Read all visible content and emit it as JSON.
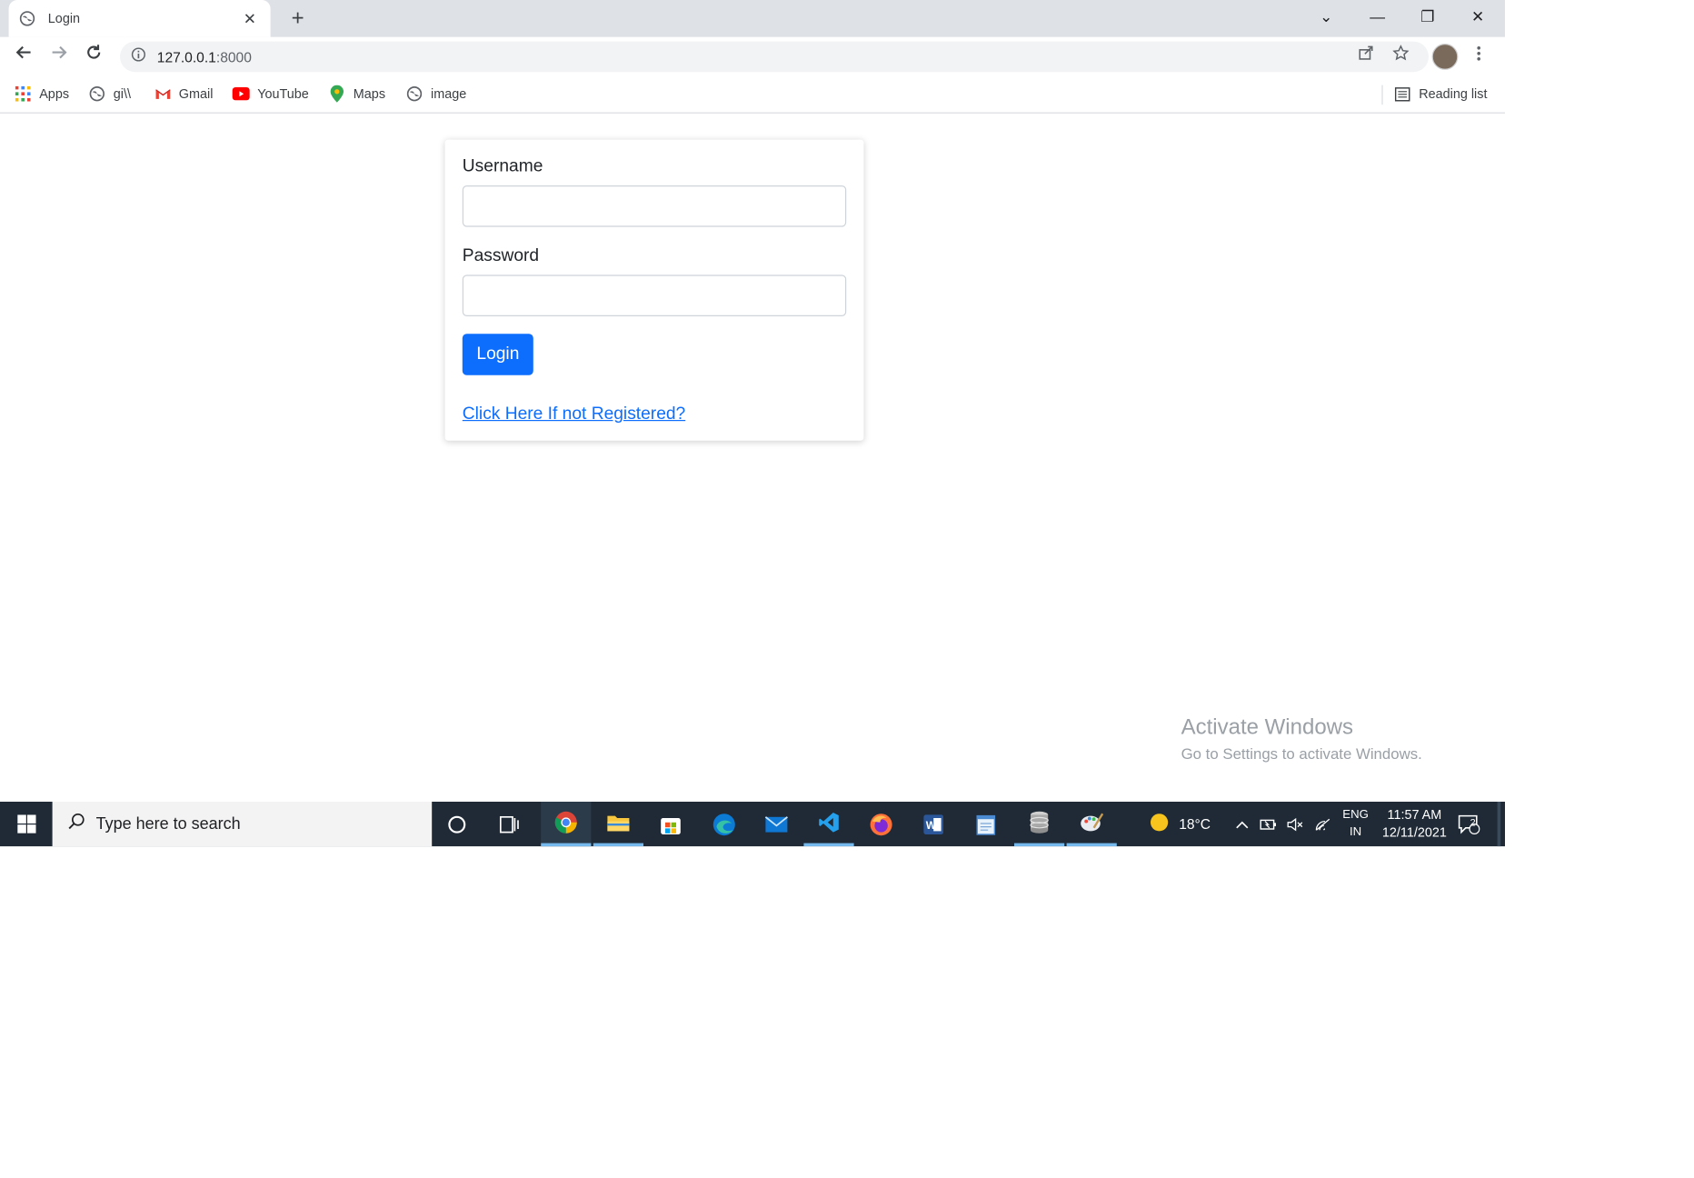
{
  "browser": {
    "tab_title": "Login",
    "close_tab": "✕",
    "new_tab": "+",
    "url_host": "127.0.0.1",
    "url_port": ":8000",
    "window_controls": {
      "dropdown": "⌄",
      "minimize": "—",
      "restore": "❐",
      "close": "✕"
    }
  },
  "bookmarks": [
    {
      "label": "Apps",
      "icon": "apps-grid-icon"
    },
    {
      "label": "gi\\\\",
      "icon": "globe-icon"
    },
    {
      "label": "Gmail",
      "icon": "gmail-icon"
    },
    {
      "label": "YouTube",
      "icon": "youtube-icon"
    },
    {
      "label": "Maps",
      "icon": "maps-pin-icon"
    },
    {
      "label": "image",
      "icon": "globe-icon"
    }
  ],
  "reading_list": "Reading list",
  "form": {
    "username_label": "Username",
    "username_value": "",
    "password_label": "Password",
    "password_value": "",
    "login_button": "Login",
    "register_link": "Click Here If not Registered?"
  },
  "watermark": {
    "line1": "Activate Windows",
    "line2": "Go to Settings to activate Windows."
  },
  "taskbar": {
    "search_placeholder": "Type here to search",
    "weather": "18°C",
    "lang_top": "ENG",
    "lang_bottom": "IN",
    "time": "11:57 AM",
    "date": "12/11/2021",
    "notification_count": "2"
  },
  "colors": {
    "primary": "#0d6efd",
    "tabstrip": "#dee1e6",
    "taskbar": "#1f2a36"
  }
}
